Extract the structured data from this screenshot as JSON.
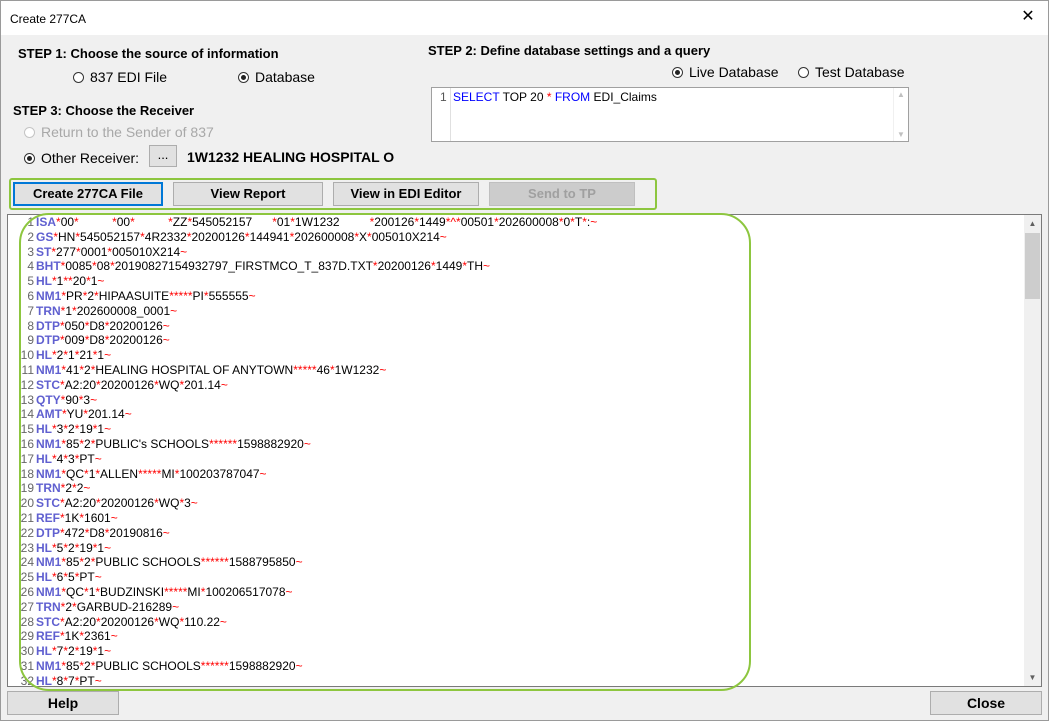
{
  "window": {
    "title": "Create 277CA",
    "close_glyph": "✕"
  },
  "step1": {
    "label": "STEP 1: Choose the source of information",
    "options": [
      {
        "label": "837 EDI File",
        "selected": false
      },
      {
        "label": "Database",
        "selected": true
      }
    ]
  },
  "step2": {
    "label": "STEP 2: Define database settings and a query",
    "options": [
      {
        "label": "Live Database",
        "selected": true
      },
      {
        "label": "Test Database",
        "selected": false
      }
    ],
    "query": {
      "line_number": "1",
      "kw1": "SELECT",
      "mid": " TOP 20  ",
      "star": "*",
      "kw2": " FROM",
      "table": " EDI_Claims"
    }
  },
  "step3": {
    "label": "STEP 3: Choose the Receiver",
    "return_label": "Return to the Sender of 837",
    "other_label": "Other Receiver:",
    "browse_label": "...",
    "receiver_value": "1W1232 HEALING HOSPITAL O"
  },
  "toolbar": {
    "create_label": "Create 277CA File",
    "view_report_label": "View Report",
    "view_editor_label": "View in EDI Editor",
    "send_label": "Send to TP"
  },
  "footer": {
    "help_label": "Help",
    "close_label": "Close"
  },
  "editor_lines": [
    {
      "n": "1",
      "seg": "ISA",
      "rest": "*00*          *00*          *ZZ*545052157      *01*1W1232         *200126*1449*^*00501*202600008*0*T*:~"
    },
    {
      "n": "2",
      "seg": "GS",
      "rest": "*HN*545052157*4R2332*20200126*144941*202600008*X*005010X214~"
    },
    {
      "n": "3",
      "seg": "ST",
      "rest": "*277*0001*005010X214~"
    },
    {
      "n": "4",
      "seg": "BHT",
      "rest": "*0085*08*20190827154932797_FIRSTMCO_T_837D.TXT*20200126*1449*TH~"
    },
    {
      "n": "5",
      "seg": "HL",
      "rest": "*1**20*1~"
    },
    {
      "n": "6",
      "seg": "NM1",
      "rest": "*PR*2*HIPAASUITE*****PI*555555~"
    },
    {
      "n": "7",
      "seg": "TRN",
      "rest": "*1*202600008_0001~"
    },
    {
      "n": "8",
      "seg": "DTP",
      "rest": "*050*D8*20200126~"
    },
    {
      "n": "9",
      "seg": "DTP",
      "rest": "*009*D8*20200126~"
    },
    {
      "n": "10",
      "seg": "HL",
      "rest": "*2*1*21*1~"
    },
    {
      "n": "11",
      "seg": "NM1",
      "rest": "*41*2*HEALING HOSPITAL OF ANYTOWN*****46*1W1232~"
    },
    {
      "n": "12",
      "seg": "STC",
      "rest": "*A2:20*20200126*WQ*201.14~"
    },
    {
      "n": "13",
      "seg": "QTY",
      "rest": "*90*3~"
    },
    {
      "n": "14",
      "seg": "AMT",
      "rest": "*YU*201.14~"
    },
    {
      "n": "15",
      "seg": "HL",
      "rest": "*3*2*19*1~"
    },
    {
      "n": "16",
      "seg": "NM1",
      "rest": "*85*2*PUBLIC's SCHOOLS******1598882920~"
    },
    {
      "n": "17",
      "seg": "HL",
      "rest": "*4*3*PT~"
    },
    {
      "n": "18",
      "seg": "NM1",
      "rest": "*QC*1*ALLEN*****MI*100203787047~"
    },
    {
      "n": "19",
      "seg": "TRN",
      "rest": "*2*2~"
    },
    {
      "n": "20",
      "seg": "STC",
      "rest": "*A2:20*20200126*WQ*3~"
    },
    {
      "n": "21",
      "seg": "REF",
      "rest": "*1K*1601~"
    },
    {
      "n": "22",
      "seg": "DTP",
      "rest": "*472*D8*20190816~"
    },
    {
      "n": "23",
      "seg": "HL",
      "rest": "*5*2*19*1~"
    },
    {
      "n": "24",
      "seg": "NM1",
      "rest": "*85*2*PUBLIC SCHOOLS******1588795850~"
    },
    {
      "n": "25",
      "seg": "HL",
      "rest": "*6*5*PT~"
    },
    {
      "n": "26",
      "seg": "NM1",
      "rest": "*QC*1*BUDZINSKI*****MI*100206517078~"
    },
    {
      "n": "27",
      "seg": "TRN",
      "rest": "*2*GARBUD-216289~"
    },
    {
      "n": "28",
      "seg": "STC",
      "rest": "*A2:20*20200126*WQ*110.22~"
    },
    {
      "n": "29",
      "seg": "REF",
      "rest": "*1K*2361~"
    },
    {
      "n": "30",
      "seg": "HL",
      "rest": "*7*2*19*1~"
    },
    {
      "n": "31",
      "seg": "NM1",
      "rest": "*85*2*PUBLIC SCHOOLS******1598882920~"
    },
    {
      "n": "32",
      "seg": "HL",
      "rest": "*8*7*PT~"
    }
  ],
  "colors": {
    "accent_green": "#8dc63f",
    "segment_blue": "#6060d0",
    "separator_red": "#ff0000"
  }
}
